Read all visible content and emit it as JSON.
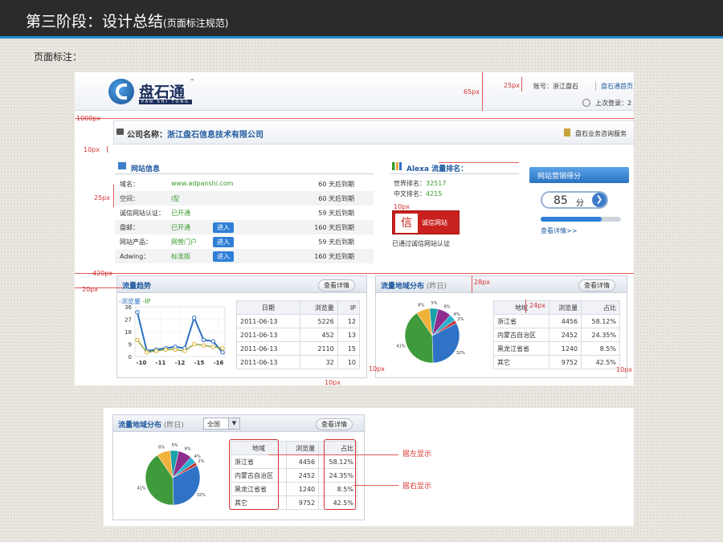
{
  "title": {
    "main": "第三阶段：设计总结",
    "sub": "(页面标注规范)"
  },
  "page_label": "页面标注：",
  "logo": {
    "cn": "盘石通",
    "en": "PAN SHI TONG",
    "tm": "™"
  },
  "header": {
    "account": "账号：浙江盘石",
    "home_link": "盘石通首页",
    "last_login": "上次登录：2"
  },
  "company": {
    "label": "公司名称：",
    "name": "浙江盘石信息技术有限公司",
    "consult": "盘石业务咨询服务"
  },
  "site_info": {
    "title": "网站信息",
    "enter_label": "进入",
    "rows": [
      {
        "key": "域名：",
        "value": "www.adpanshi.com",
        "expire": "60 天后到期",
        "enter": false
      },
      {
        "key": "空间：",
        "value": "I型",
        "expire": "60 天后到期",
        "enter": false
      },
      {
        "key": "诚信网站认证：",
        "value": "已开通",
        "expire": "59 天后到期",
        "enter": false
      },
      {
        "key": "盘邮：",
        "value": "已开通",
        "expire": "160 天后到期",
        "enter": true
      },
      {
        "key": "网站产品：",
        "value": "网营门户",
        "expire": "59 天后到期",
        "enter": true
      },
      {
        "key": "Adwing：",
        "value": "标准版",
        "expire": "160 天后到期",
        "enter": true
      }
    ]
  },
  "alexa": {
    "title": "Alexa 流量排名：",
    "world_label": "世界排名：",
    "world": "32517",
    "cn_label": "中文排名：",
    "cn": "4215",
    "badge": "诚信网站",
    "cert": "已通过诚信网站认证"
  },
  "score": {
    "title": "网站营销得分",
    "value": "85",
    "unit": "分",
    "detail": "查看详情>>",
    "progress": 0.76
  },
  "traffic": {
    "title": "流量趋势",
    "detail": "查看详情",
    "legend_pv": "-浏览量",
    "legend_ip": "-IP",
    "columns": [
      "日期",
      "浏览量",
      "IP"
    ],
    "rows": [
      [
        "2011-06-13",
        "5226",
        "12"
      ],
      [
        "2011-06-13",
        "452",
        "13"
      ],
      [
        "2011-06-13",
        "2110",
        "15"
      ],
      [
        "2011-06-13",
        "32",
        "10"
      ]
    ]
  },
  "traffic_chart": {
    "type": "line",
    "y_ticks": [
      "36",
      "27",
      "18",
      "9",
      "0"
    ],
    "x_ticks": [
      "-10",
      "-11",
      "-12",
      "-15",
      "-16"
    ],
    "ylim": [
      0,
      36
    ],
    "series": [
      {
        "name": "-浏览量",
        "color": "#2e6fc0",
        "values": [
          32,
          4,
          5,
          6,
          7,
          6,
          28,
          12,
          11,
          3
        ]
      },
      {
        "name": "-IP",
        "color": "#8aa83a",
        "values": [
          12,
          3,
          4,
          5,
          5,
          4,
          9,
          8,
          7,
          6
        ]
      }
    ]
  },
  "region": {
    "title": "流量地域分布",
    "sub": "(昨日)",
    "detail": "查看详情",
    "columns": [
      "地域",
      "浏览量",
      "占比"
    ],
    "rows": [
      [
        "浙江省",
        "4456",
        "58.12%"
      ],
      [
        "内蒙古自治区",
        "2452",
        "24.35%"
      ],
      [
        "黑龙江省省",
        "1240",
        "8.5%"
      ],
      [
        "其它",
        "9752",
        "42.5%"
      ]
    ]
  },
  "pie": {
    "type": "pie",
    "slices": [
      {
        "value": 32,
        "color": "#2f72c6",
        "label": "32%"
      },
      {
        "value": 41,
        "color": "#3e9a3a",
        "label": "41%"
      },
      {
        "value": 8,
        "color": "#f0b23a",
        "label": "8%"
      },
      {
        "value": 5,
        "color": "#1aa0a8",
        "label": "5%"
      },
      {
        "value": 8,
        "color": "#8e2d8e",
        "label": "8%"
      },
      {
        "value": 4,
        "color": "#2ab0d0",
        "label": "4%"
      },
      {
        "value": 2,
        "color": "#c43434",
        "label": "2%"
      }
    ]
  },
  "detail_panel": {
    "title": "流量地域分布",
    "sub": "(昨日)",
    "select": "全国",
    "detail": "查看详情",
    "note_left": "居左显示",
    "note_right": "居右显示"
  },
  "annotations": {
    "m65": "65px",
    "m25a": "25px",
    "m1000": "1000px",
    "m10a": "10px",
    "m25b": "25px",
    "m10b": "10px",
    "m420": "420px",
    "m20": "20px",
    "m28": "28px",
    "m24": "24px",
    "m10c": "10px",
    "m10d": "10px",
    "m10e": "10px"
  }
}
